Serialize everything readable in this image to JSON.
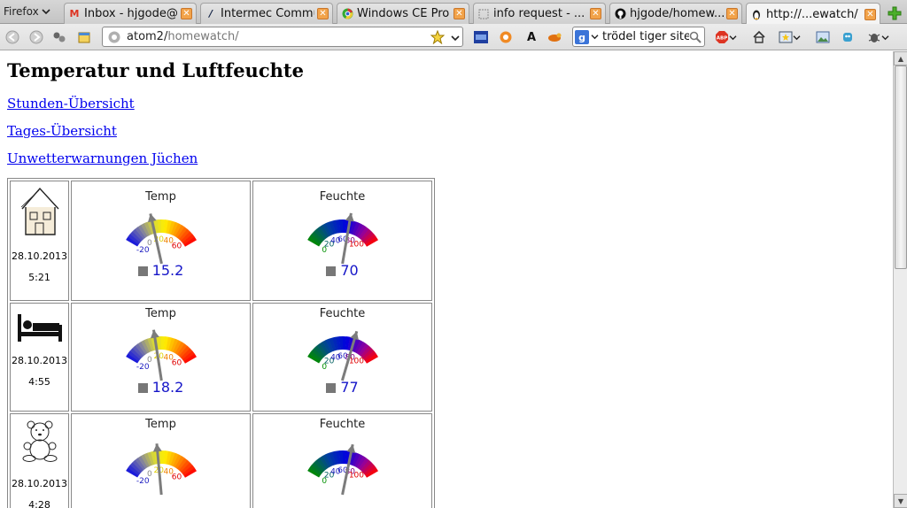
{
  "browser": {
    "menu_label": "Firefox",
    "tabs": [
      {
        "label": "Inbox - hjgode@",
        "icon": "gmail-icon",
        "active": false
      },
      {
        "label": "Intermec Commu",
        "icon": "intermec-icon",
        "active": false
      },
      {
        "label": "Windows CE Pro",
        "icon": "chrome-icon",
        "active": false
      },
      {
        "label": "info request - ...",
        "icon": "page-icon",
        "active": false
      },
      {
        "label": "hjgode/homew...",
        "icon": "github-icon",
        "active": false
      },
      {
        "label": "http://...ewatch/",
        "icon": "tux-icon",
        "active": true
      }
    ],
    "url_host": "atom2/",
    "url_path": "homewatch/",
    "search_text": "trödel tiger site"
  },
  "page": {
    "title": "Temperatur und Luftfeuchte",
    "links": [
      "Stunden-Übersicht",
      "Tages-Übersicht",
      "Unwetterwarnungen Jüchen"
    ]
  },
  "sensors": [
    {
      "icon": "house-icon",
      "date": "28.10.2013",
      "time": "5:21",
      "temp": {
        "title": "Temp",
        "value": "15.2",
        "level": 15.2
      },
      "humid": {
        "title": "Feuchte",
        "value": "70",
        "level": 70
      }
    },
    {
      "icon": "bed-icon",
      "date": "28.10.2013",
      "time": "4:55",
      "temp": {
        "title": "Temp",
        "value": "18.2",
        "level": 18.2
      },
      "humid": {
        "title": "Feuchte",
        "value": "77",
        "level": 77
      }
    },
    {
      "icon": "teddy-bear-icon",
      "date": "28.10.2013",
      "time": "4:28",
      "temp": {
        "title": "Temp",
        "value": "",
        "level": 21
      },
      "humid": {
        "title": "Feuchte",
        "value": "",
        "level": 72
      }
    }
  ],
  "gauge_scales": {
    "temp": {
      "min": -20,
      "max": 70,
      "labels": [
        "-20",
        "0",
        "20",
        "40",
        "60"
      ],
      "label_colors": [
        "#1a1ac0",
        "#888888",
        "#e0d000",
        "#f08000",
        "#e00000"
      ]
    },
    "humid": {
      "min": 0,
      "max": 120,
      "labels": [
        "0",
        "20",
        "40",
        "60",
        "80",
        "100"
      ],
      "label_colors": [
        "#009000",
        "#006060",
        "#2020c0",
        "#2020c0",
        "#800080",
        "#e00000"
      ]
    }
  }
}
